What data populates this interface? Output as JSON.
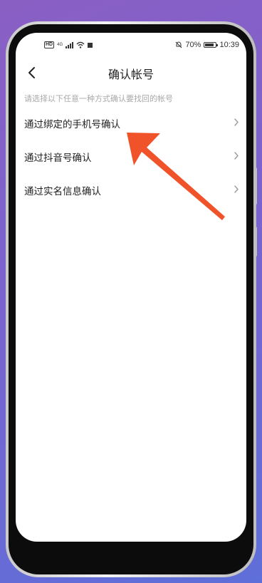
{
  "status_bar": {
    "hd": "HD",
    "signal_tag": "4G",
    "battery": "70%",
    "battery_level": 0.7,
    "time": "10:39"
  },
  "header": {
    "title": "确认帐号"
  },
  "instruction": "请选择以下任意一种方式确认要找回的帐号",
  "options": [
    {
      "label": "通过绑定的手机号确认"
    },
    {
      "label": "通过抖音号确认"
    },
    {
      "label": "通过实名信息确认"
    }
  ],
  "colors": {
    "arrow": "#f0522a",
    "background": "#7a63cf",
    "chevron": "#9a9a9a"
  },
  "icons": [
    "back-arrow-icon",
    "chevron-right-icon",
    "wifi-icon",
    "signal-icon",
    "battery-icon",
    "mute-icon"
  ]
}
